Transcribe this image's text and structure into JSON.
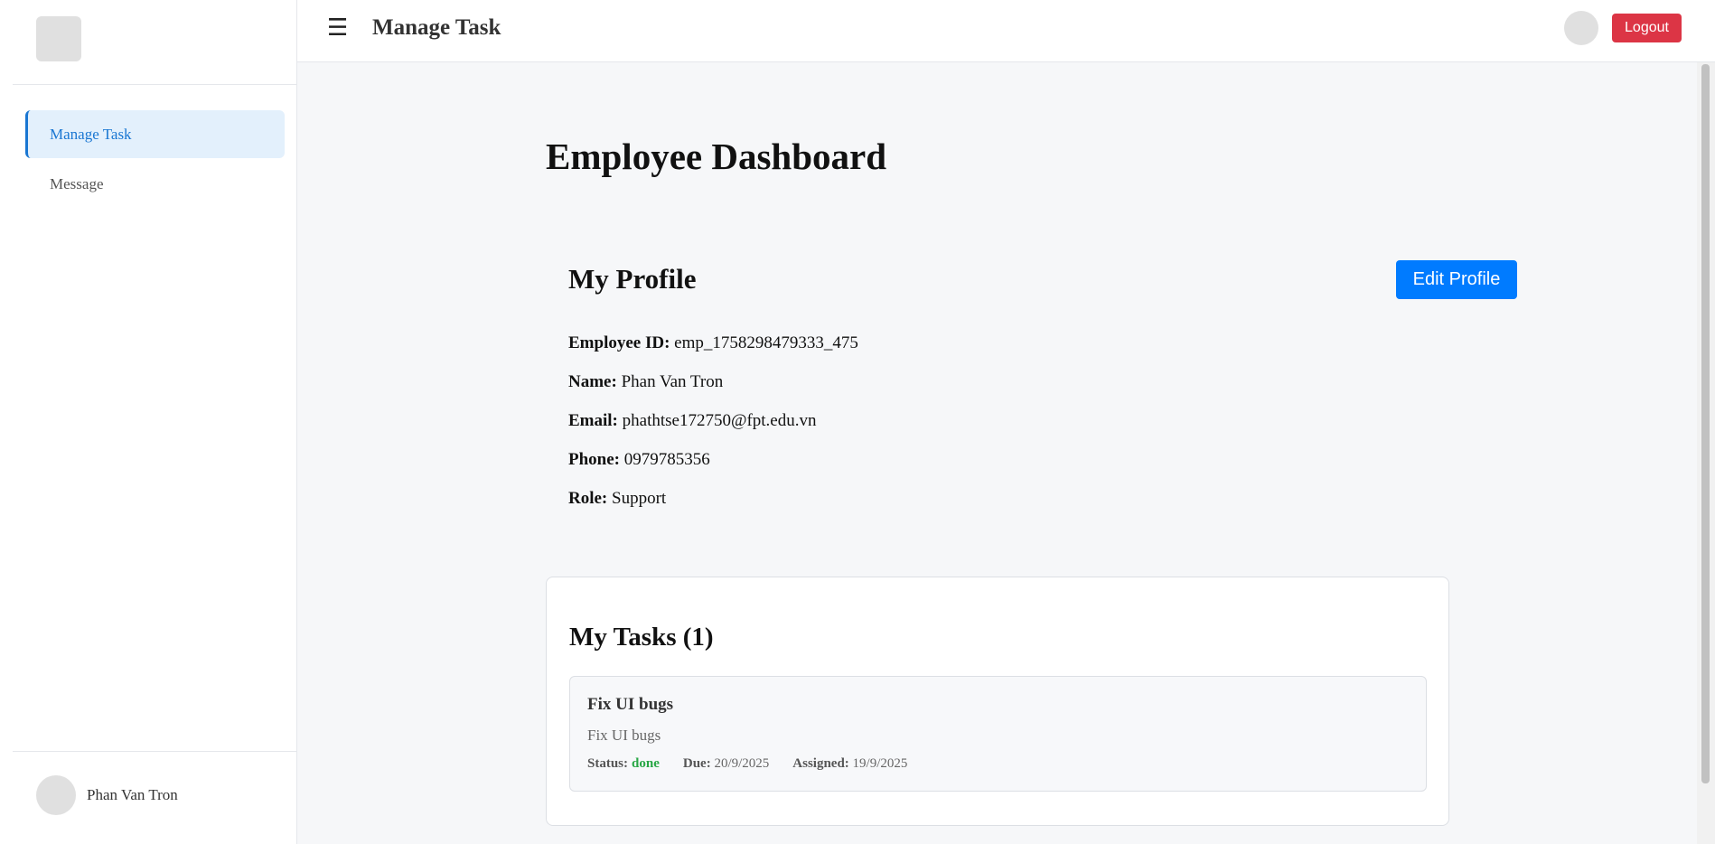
{
  "sidebar": {
    "items": [
      {
        "label": "Manage Task",
        "active": true
      },
      {
        "label": "Message",
        "active": false
      }
    ],
    "user_name": "Phan Van Tron"
  },
  "header": {
    "menu_icon": "☰",
    "title": "Manage Task",
    "logout_label": "Logout"
  },
  "main": {
    "page_title": "Employee Dashboard",
    "profile": {
      "title": "My Profile",
      "edit_label": "Edit Profile",
      "fields": [
        {
          "label": "Employee ID:",
          "value": "emp_1758298479333_475"
        },
        {
          "label": "Name:",
          "value": "Phan Van Tron"
        },
        {
          "label": "Email:",
          "value": "phathtse172750@fpt.edu.vn"
        },
        {
          "label": "Phone:",
          "value": "0979785356"
        },
        {
          "label": "Role:",
          "value": "Support"
        }
      ]
    },
    "tasks": {
      "title": "My Tasks (1)",
      "items": [
        {
          "title": "Fix UI bugs",
          "description": "Fix UI bugs",
          "status_label": "Status:",
          "status": "done",
          "due_label": "Due:",
          "due": "20/9/2025",
          "assigned_label": "Assigned:",
          "assigned": "19/9/2025"
        }
      ]
    }
  },
  "colors": {
    "accent": "#007bff",
    "nav_active": "#1976d2",
    "nav_active_bg": "#e3f0fc",
    "danger": "#dc3545",
    "status_done": "#28a745"
  }
}
